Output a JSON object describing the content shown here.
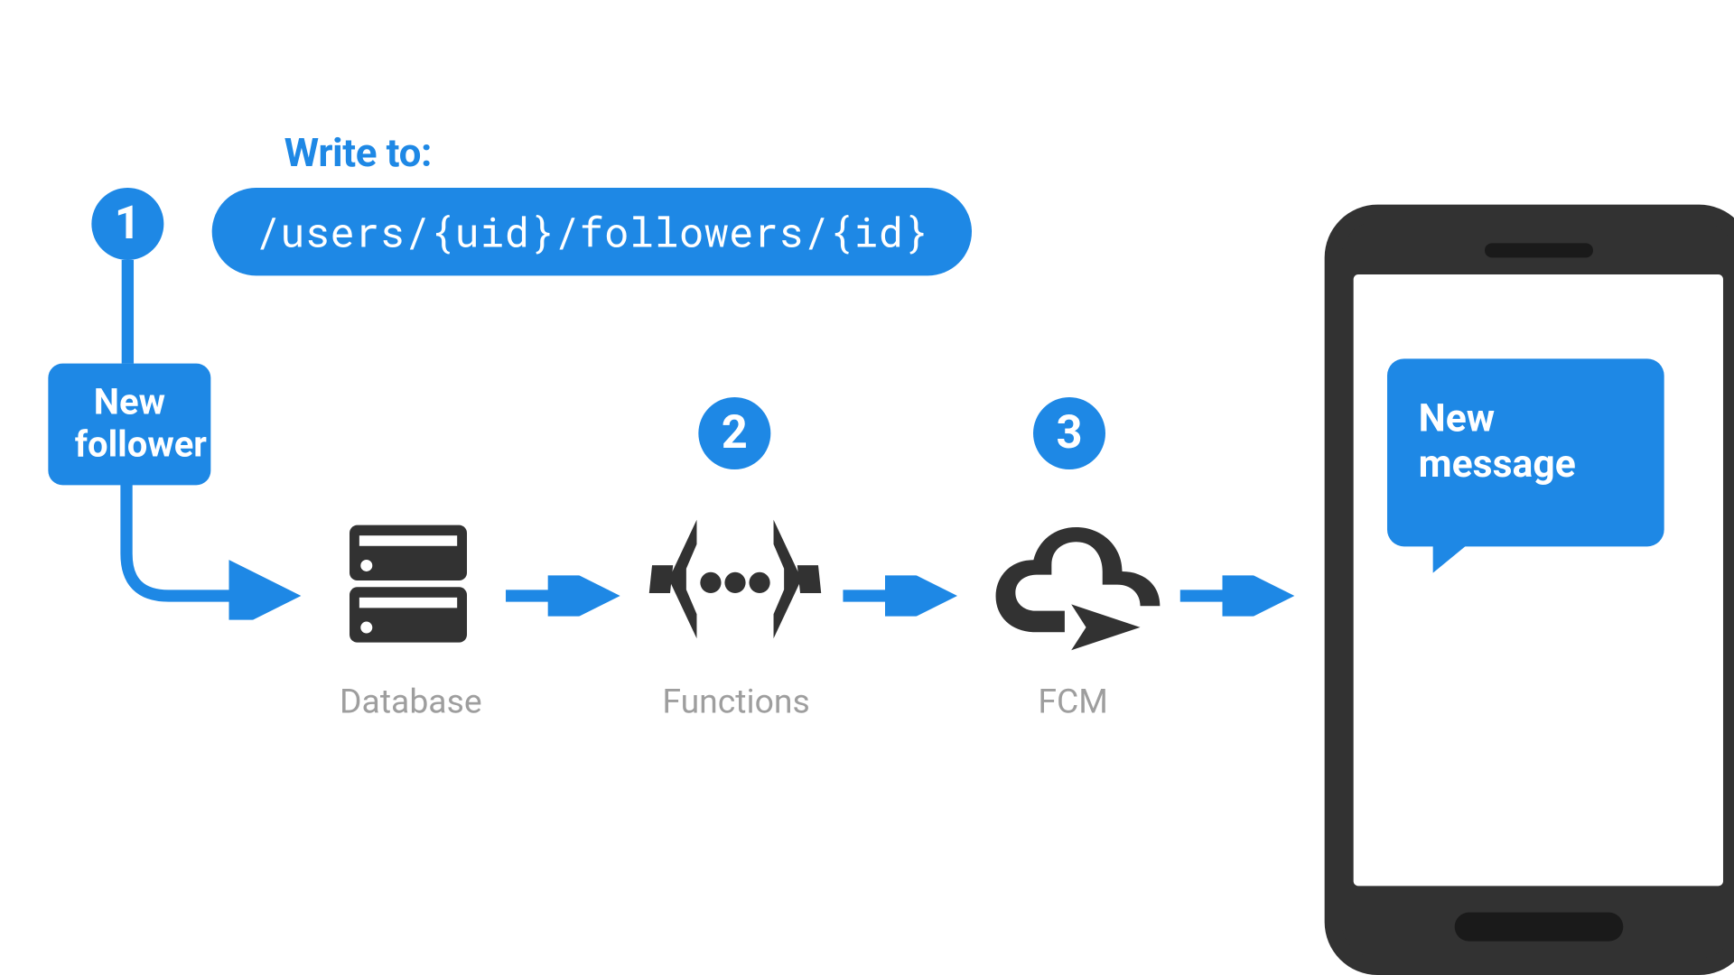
{
  "colors": {
    "accent": "#1e88e5",
    "icon": "#323232",
    "label": "#9e9e9e"
  },
  "header": {
    "write_label": "Write to:",
    "path": "/users/{uid}/followers/{id}"
  },
  "steps": {
    "one": "1",
    "two": "2",
    "three": "3"
  },
  "event_box": {
    "line1": "New",
    "line2": "follower"
  },
  "services": {
    "database": "Database",
    "functions": "Functions",
    "fcm": "FCM"
  },
  "notification": {
    "line1": "New",
    "line2": "message"
  }
}
